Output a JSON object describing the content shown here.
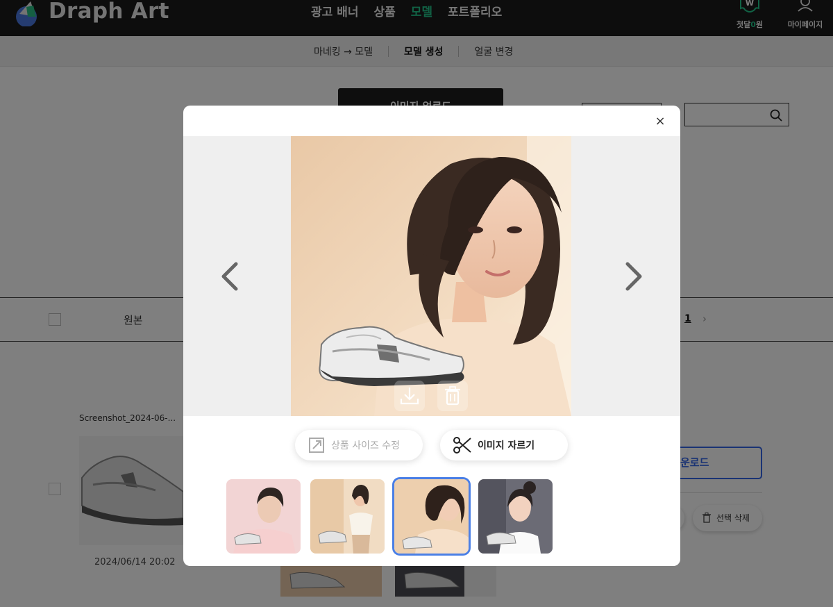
{
  "header": {
    "brand": "Draph Art",
    "nav": [
      "광고 배너",
      "상품",
      "모델",
      "포트폴리오"
    ],
    "active_nav": "모델",
    "wallet_prefix": "첫달",
    "wallet_amount": "0",
    "wallet_suffix": "원",
    "wallet_icon_label": "W",
    "mypage": "마이페이지"
  },
  "subnav": {
    "items": [
      "마네킹 → 모델",
      "모델 생성",
      "얼굴 변경"
    ],
    "active": "모델 생성"
  },
  "background": {
    "upload_button": "이미지 업로드",
    "table_header_original": "원본",
    "page_number": "1",
    "next_page": "›",
    "row_filename": "Screenshot_2024-06-...",
    "row_date": "2024/06/14 20:02",
    "download_button": "운로드",
    "delete_selected": "선택 삭제"
  },
  "modal": {
    "close": "×",
    "resize_button": "상품 사이즈 수정",
    "crop_button": "이미지 자르기",
    "thumbnails": [
      {
        "icon": "model-male-pink-thumbnail",
        "selected": false
      },
      {
        "icon": "model-full-body-beige-thumbnail",
        "selected": false
      },
      {
        "icon": "model-short-hair-thumbnail",
        "selected": true
      },
      {
        "icon": "model-bun-hair-gray-thumbnail",
        "selected": false
      }
    ]
  },
  "colors": {
    "accent_green": "#22c58b",
    "accent_blue": "#4a7fe6",
    "topbar": "#1a1a1a"
  }
}
